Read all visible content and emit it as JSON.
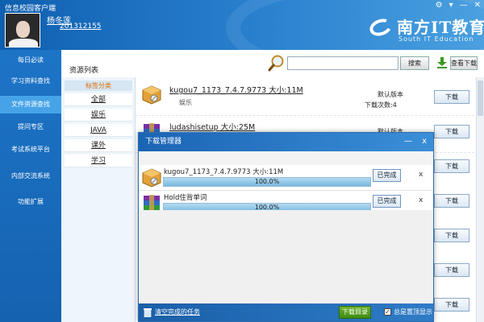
{
  "app": {
    "title": "信息校园客户端",
    "window_controls": [
      "⚙",
      "▾",
      "—",
      "✕"
    ]
  },
  "user": {
    "name": "杨冬莲",
    "id": "201312155"
  },
  "brand": {
    "name_cn": "南方IT教育",
    "name_en": "South IT Education"
  },
  "sidebar": {
    "items": [
      {
        "label": "每日必读",
        "active": false
      },
      {
        "label": "学习资料查找",
        "active": false
      },
      {
        "label": "文件资源查找",
        "active": true
      },
      {
        "label": "提问专区",
        "active": false
      },
      {
        "label": "考试系统平台",
        "active": false
      },
      {
        "label": "内部交流系统",
        "active": false
      },
      {
        "label": "功能扩展",
        "active": false
      }
    ]
  },
  "main": {
    "title": "资源列表",
    "search": {
      "placeholder": "",
      "button": "搜索"
    },
    "view_downloads_button": "查看下载",
    "categories": {
      "header": "标签分类",
      "items": [
        "全部",
        "娱乐",
        "JAVA",
        "课外",
        "学习"
      ]
    },
    "resources": [
      {
        "name": "kugou7_1173_7.4.7.9773 大小:11M",
        "tag": "娱乐",
        "version": "默认版本",
        "downloads": "下载次数:4",
        "icon": "package-icon"
      },
      {
        "name": "ludashisetup 大小:25M",
        "tag": "",
        "version": "默认版本",
        "downloads": "",
        "icon": "winrar-icon"
      }
    ],
    "download_button_label": "下载",
    "download_button_count": 8
  },
  "download_manager": {
    "title": "下载管理器",
    "minimize": "—",
    "close": "x",
    "tasks": [
      {
        "name": "kugou7_1173_7.4.7.9773 大小:11M",
        "progress": 1.0,
        "progress_text": "100.0%",
        "status_button": "已完成",
        "remove": "x",
        "icon": "package-icon"
      },
      {
        "name": "Hold住背单词",
        "progress": 1.0,
        "progress_text": "100.0%",
        "status_button": "已完成",
        "remove": "x",
        "icon": "winrar-icon"
      }
    ],
    "clear_link": "清空完成的任务",
    "download_dir_button": "下载目录",
    "always_on_top": {
      "label": "总是置顶显示",
      "checked": true,
      "mark": "✓"
    }
  },
  "colors": {
    "header_blue": "#1f6fbf",
    "sidebar_blue": "#1968ba",
    "sidebar_active": "#46a3e8",
    "green_button": "#4f9a1d",
    "category_header_text": "#e06a00"
  }
}
